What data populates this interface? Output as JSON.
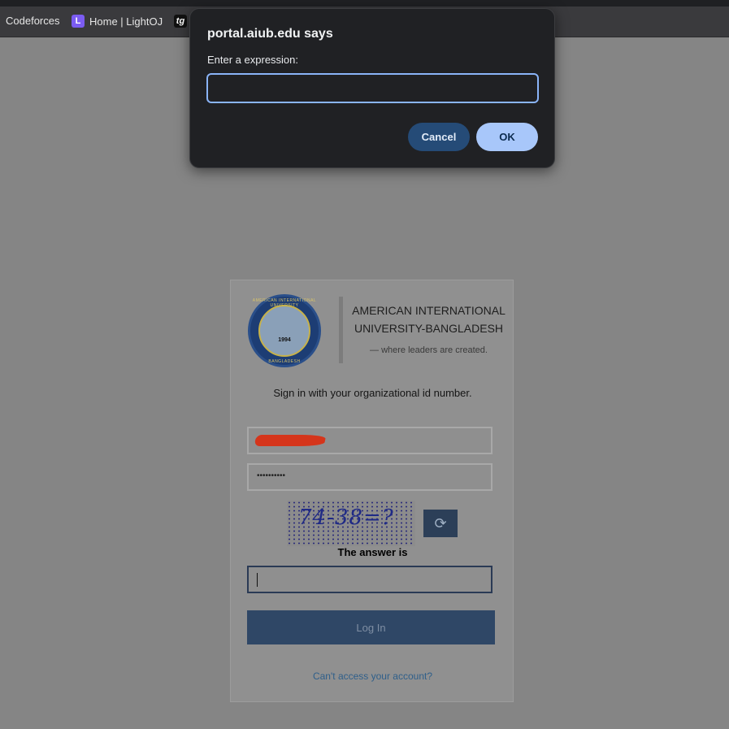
{
  "bookmarks": [
    {
      "label": "Codeforces"
    },
    {
      "icon": "L",
      "label": "Home | LightOJ"
    },
    {
      "icon": "tg",
      "label": ""
    }
  ],
  "login": {
    "university_name": "AMERICAN INTERNATIONAL UNIVERSITY-BANGLADESH",
    "tagline": "— where leaders are created.",
    "signin_prompt": "Sign in with your organizational id number.",
    "password_value": "••••••••••",
    "captcha_text": "74-38=?",
    "answer_label": "The answer is",
    "login_button": "Log In",
    "forgot_link": "Can't access your account?",
    "logo": {
      "ring_text": "AMERICAN INTERNATIONAL UNIVERSITY",
      "year": "1994",
      "bottom_text": "BANGLADESH"
    }
  },
  "dialog": {
    "title": "portal.aiub.edu says",
    "message": "Enter a expression:",
    "input_value": "",
    "cancel": "Cancel",
    "ok": "OK"
  },
  "colors": {
    "dialog_bg": "#202124",
    "ok_button": "#a8c7fa",
    "cancel_button": "#254b77",
    "login_button": "#2f4766"
  }
}
